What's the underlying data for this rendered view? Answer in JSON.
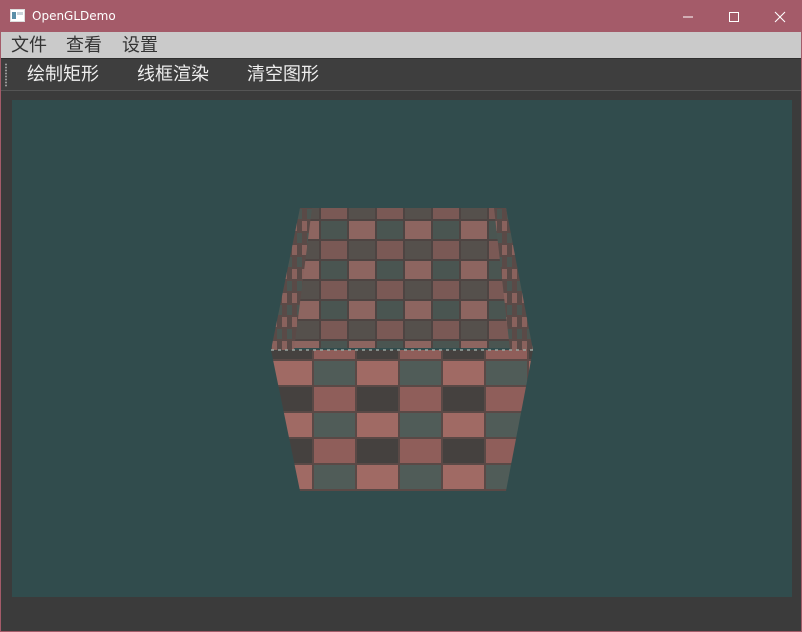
{
  "window": {
    "title": "OpenGLDemo",
    "icon": "app-window-icon",
    "controls": [
      "minimize-icon",
      "maximize-icon",
      "close-icon"
    ]
  },
  "menubar": {
    "items": [
      {
        "label": "文件"
      },
      {
        "label": "查看"
      },
      {
        "label": "设置"
      }
    ]
  },
  "toolbar": {
    "items": [
      {
        "label": "绘制矩形"
      },
      {
        "label": "线框渲染"
      },
      {
        "label": "清空图形"
      }
    ]
  },
  "viewport": {
    "background_color": "#314c4d",
    "scene": "textured-cube",
    "texture": "checkered-brick"
  },
  "colors": {
    "titlebar": "#a45b69",
    "menubar": "#cacaca",
    "toolbar": "#3e3e3e",
    "status": "#3b3b3b"
  }
}
